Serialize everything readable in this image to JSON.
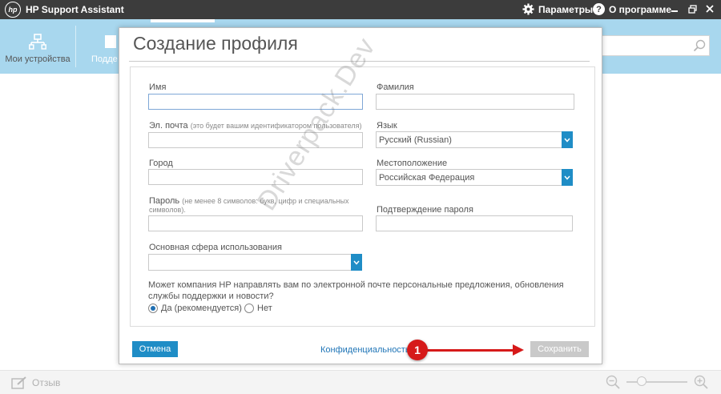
{
  "app": {
    "title": "HP Support Assistant",
    "logo_text": "hp",
    "settings_label": "Параметры",
    "about_label": "О программе",
    "help_glyph": "?"
  },
  "nav": {
    "devices_label": "Мои устройства",
    "support_label": "Подде"
  },
  "dialog": {
    "title": "Создание профиля",
    "fields": {
      "first_name": {
        "label": "Имя",
        "value": ""
      },
      "last_name": {
        "label": "Фамилия",
        "value": ""
      },
      "email": {
        "label": "Эл. почта",
        "hint": "(это будет вашим идентификатором пользователя)",
        "value": ""
      },
      "language": {
        "label": "Язык",
        "value": "Русский (Russian)"
      },
      "city": {
        "label": "Город",
        "value": ""
      },
      "location": {
        "label": "Местоположение",
        "value": "Российская Федерация"
      },
      "password": {
        "label": "Пароль",
        "hint_line1": "(не менее 8 символов: букв, цифр и специальных",
        "hint_line2": "символов).",
        "value": ""
      },
      "password_confirm": {
        "label": "Подтверждение пароля",
        "value": ""
      },
      "usage": {
        "label": "Основная сфера использования",
        "value": ""
      }
    },
    "question": "Может компания HP направлять вам по электронной почте персональные предложения, обновления службы поддержки и новости?",
    "options": [
      {
        "label": "Да (рекомендуется)",
        "selected": true
      },
      {
        "label": "Нет",
        "selected": false
      }
    ],
    "cancel_label": "Отмена",
    "privacy_label": "Конфиденциальность",
    "save_label": "Сохранить"
  },
  "bottom": {
    "feedback_label": "Отзыв",
    "zoom_level": 0.2
  },
  "annotation": {
    "badge": "1"
  },
  "watermark": "Driverpack.Dev",
  "colors": {
    "titlebar": "#3c3c3c",
    "nav": "#a8d7ee",
    "accent": "#1f8dc6",
    "annotation": "#d61a1a"
  }
}
